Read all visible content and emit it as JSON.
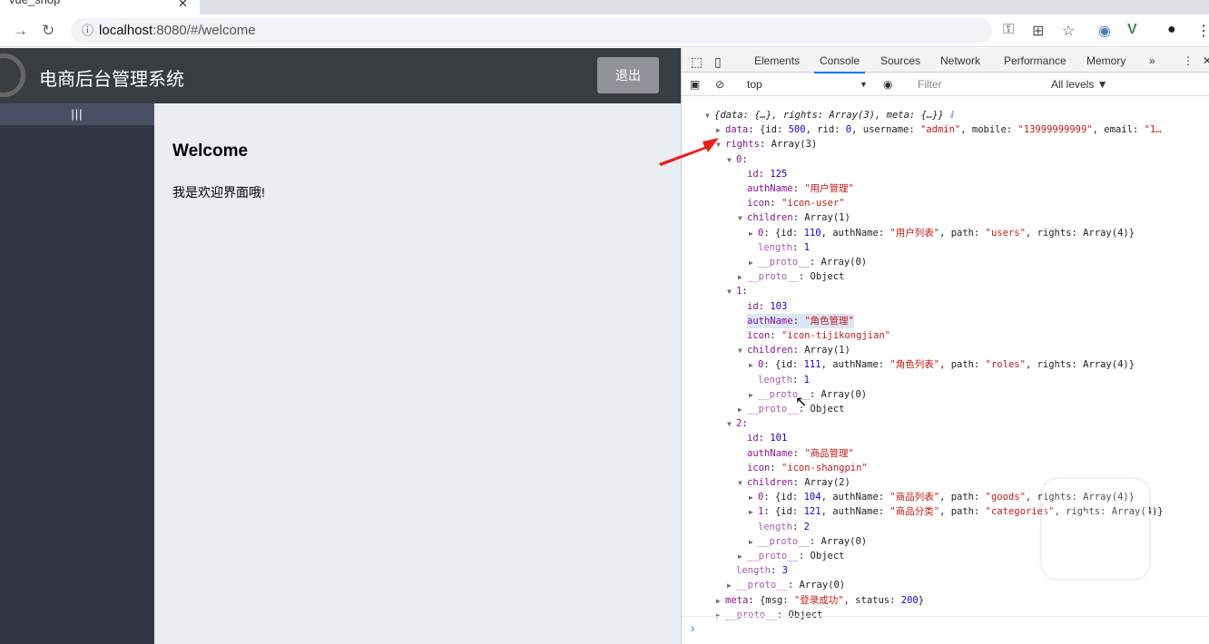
{
  "browser": {
    "tab_title": "vue_shop",
    "url_host": "localhost",
    "url_rest": ":8080/#/welcome"
  },
  "app": {
    "title": "电商后台管理系统",
    "logout": "退出",
    "toggle": "|||",
    "welcome_title": "Welcome",
    "welcome_text": "我是欢迎界面哦!"
  },
  "devtools": {
    "tabs": [
      "Elements",
      "Console",
      "Sources",
      "Network",
      "Performance",
      "Memory"
    ],
    "active_tab": "Console",
    "context": "top",
    "filter_placeholder": "Filter",
    "levels": "All levels ▼",
    "lines": [
      {
        "d": 0,
        "t": "open",
        "seg": [
          [
            "p",
            "{data: {…}, rights: Array(3), meta: {…}}"
          ]
        ],
        "italic": true
      },
      {
        "d": 1,
        "t": "closed",
        "seg": [
          [
            "k",
            "data"
          ],
          [
            "p",
            ": {id: "
          ],
          [
            "n",
            "500"
          ],
          [
            "p",
            ", rid: "
          ],
          [
            "n",
            "0"
          ],
          [
            "p",
            ", username: "
          ],
          [
            "s",
            "\"admin\""
          ],
          [
            "p",
            ", mobile: "
          ],
          [
            "s",
            "\"13999999999\""
          ],
          [
            "p",
            ", email: "
          ],
          [
            "s",
            "\"1…"
          ]
        ]
      },
      {
        "d": 1,
        "t": "open",
        "seg": [
          [
            "k",
            "rights"
          ],
          [
            "p",
            ": Array(3)"
          ]
        ]
      },
      {
        "d": 2,
        "t": "open",
        "seg": [
          [
            "k",
            "0"
          ],
          [
            "p",
            ":"
          ]
        ]
      },
      {
        "d": 3,
        "t": "leaf",
        "seg": [
          [
            "k",
            "id"
          ],
          [
            "p",
            ": "
          ],
          [
            "n",
            "125"
          ]
        ]
      },
      {
        "d": 3,
        "t": "leaf",
        "seg": [
          [
            "k",
            "authName"
          ],
          [
            "p",
            ": "
          ],
          [
            "s",
            "\"用户管理\""
          ]
        ]
      },
      {
        "d": 3,
        "t": "leaf",
        "seg": [
          [
            "k",
            "icon"
          ],
          [
            "p",
            ": "
          ],
          [
            "s",
            "\"icon-user\""
          ]
        ]
      },
      {
        "d": 3,
        "t": "open",
        "seg": [
          [
            "k",
            "children"
          ],
          [
            "p",
            ": Array(1)"
          ]
        ]
      },
      {
        "d": 4,
        "t": "closed",
        "seg": [
          [
            "k",
            "0"
          ],
          [
            "p",
            ": {id: "
          ],
          [
            "n",
            "110"
          ],
          [
            "p",
            ", authName: "
          ],
          [
            "s",
            "\"用户列表\""
          ],
          [
            "p",
            ", path: "
          ],
          [
            "s",
            "\"users\""
          ],
          [
            "p",
            ", rights: Array(4)}"
          ]
        ]
      },
      {
        "d": 4,
        "t": "leaf",
        "seg": [
          [
            "d",
            "length"
          ],
          [
            "p",
            ": "
          ],
          [
            "n",
            "1"
          ]
        ]
      },
      {
        "d": 4,
        "t": "closed",
        "seg": [
          [
            "d",
            "__proto__"
          ],
          [
            "p",
            ": Array(0)"
          ]
        ]
      },
      {
        "d": 3,
        "t": "closed",
        "seg": [
          [
            "d",
            "__proto__"
          ],
          [
            "p",
            ": Object"
          ]
        ]
      },
      {
        "d": 2,
        "t": "open",
        "seg": [
          [
            "k",
            "1"
          ],
          [
            "p",
            ":"
          ]
        ]
      },
      {
        "d": 3,
        "t": "leaf",
        "seg": [
          [
            "k",
            "id"
          ],
          [
            "p",
            ": "
          ],
          [
            "n",
            "103"
          ]
        ]
      },
      {
        "d": 3,
        "t": "leaf",
        "hl": true,
        "seg": [
          [
            "k",
            "authName"
          ],
          [
            "p",
            ": "
          ],
          [
            "s",
            "\"角色管理\""
          ]
        ]
      },
      {
        "d": 3,
        "t": "leaf",
        "seg": [
          [
            "k",
            "icon"
          ],
          [
            "p",
            ": "
          ],
          [
            "s",
            "\"icon-tijikongjian\""
          ]
        ]
      },
      {
        "d": 3,
        "t": "open",
        "seg": [
          [
            "k",
            "children"
          ],
          [
            "p",
            ": Array(1)"
          ]
        ]
      },
      {
        "d": 4,
        "t": "closed",
        "seg": [
          [
            "k",
            "0"
          ],
          [
            "p",
            ": {id: "
          ],
          [
            "n",
            "111"
          ],
          [
            "p",
            ", authName: "
          ],
          [
            "s",
            "\"角色列表\""
          ],
          [
            "p",
            ", path: "
          ],
          [
            "s",
            "\"roles\""
          ],
          [
            "p",
            ", rights: Array(4)}"
          ]
        ]
      },
      {
        "d": 4,
        "t": "leaf",
        "seg": [
          [
            "d",
            "length"
          ],
          [
            "p",
            ": "
          ],
          [
            "n",
            "1"
          ]
        ]
      },
      {
        "d": 4,
        "t": "closed",
        "seg": [
          [
            "d",
            "__proto__"
          ],
          [
            "p",
            ": Array(0)"
          ]
        ]
      },
      {
        "d": 3,
        "t": "closed",
        "seg": [
          [
            "d",
            "__proto__"
          ],
          [
            "p",
            ": Object"
          ]
        ]
      },
      {
        "d": 2,
        "t": "open",
        "seg": [
          [
            "k",
            "2"
          ],
          [
            "p",
            ":"
          ]
        ]
      },
      {
        "d": 3,
        "t": "leaf",
        "seg": [
          [
            "k",
            "id"
          ],
          [
            "p",
            ": "
          ],
          [
            "n",
            "101"
          ]
        ]
      },
      {
        "d": 3,
        "t": "leaf",
        "seg": [
          [
            "k",
            "authName"
          ],
          [
            "p",
            ": "
          ],
          [
            "s",
            "\"商品管理\""
          ]
        ]
      },
      {
        "d": 3,
        "t": "leaf",
        "seg": [
          [
            "k",
            "icon"
          ],
          [
            "p",
            ": "
          ],
          [
            "s",
            "\"icon-shangpin\""
          ]
        ]
      },
      {
        "d": 3,
        "t": "open",
        "seg": [
          [
            "k",
            "children"
          ],
          [
            "p",
            ": Array(2)"
          ]
        ]
      },
      {
        "d": 4,
        "t": "closed",
        "seg": [
          [
            "k",
            "0"
          ],
          [
            "p",
            ": {id: "
          ],
          [
            "n",
            "104"
          ],
          [
            "p",
            ", authName: "
          ],
          [
            "s",
            "\"商品列表\""
          ],
          [
            "p",
            ", path: "
          ],
          [
            "s",
            "\"goods\""
          ],
          [
            "p",
            ", rights: Array(4)}"
          ]
        ]
      },
      {
        "d": 4,
        "t": "closed",
        "seg": [
          [
            "k",
            "1"
          ],
          [
            "p",
            ": {id: "
          ],
          [
            "n",
            "121"
          ],
          [
            "p",
            ", authName: "
          ],
          [
            "s",
            "\"商品分类\""
          ],
          [
            "p",
            ", path: "
          ],
          [
            "s",
            "\"categories\""
          ],
          [
            "p",
            ", rights: Array(4)}"
          ]
        ]
      },
      {
        "d": 4,
        "t": "leaf",
        "seg": [
          [
            "d",
            "length"
          ],
          [
            "p",
            ": "
          ],
          [
            "n",
            "2"
          ]
        ]
      },
      {
        "d": 4,
        "t": "closed",
        "seg": [
          [
            "d",
            "__proto__"
          ],
          [
            "p",
            ": Array(0)"
          ]
        ]
      },
      {
        "d": 3,
        "t": "closed",
        "seg": [
          [
            "d",
            "__proto__"
          ],
          [
            "p",
            ": Object"
          ]
        ]
      },
      {
        "d": 2,
        "t": "leaf",
        "seg": [
          [
            "d",
            "length"
          ],
          [
            "p",
            ": "
          ],
          [
            "n",
            "3"
          ]
        ]
      },
      {
        "d": 2,
        "t": "closed",
        "seg": [
          [
            "d",
            "__proto__"
          ],
          [
            "p",
            ": Array(0)"
          ]
        ]
      },
      {
        "d": 1,
        "t": "closed",
        "seg": [
          [
            "k",
            "meta"
          ],
          [
            "p",
            ": {msg: "
          ],
          [
            "s",
            "\"登录成功\""
          ],
          [
            "p",
            ", status: "
          ],
          [
            "n",
            "200"
          ],
          [
            "p",
            "}"
          ]
        ]
      },
      {
        "d": 1,
        "t": "closed",
        "seg": [
          [
            "d",
            "__proto__"
          ],
          [
            "p",
            ": Object"
          ]
        ]
      }
    ]
  },
  "colors": {
    "header": "#373d41",
    "aside": "#333744",
    "main": "#eaedf1",
    "logout": "#909399",
    "annotation_arrow": "#e8231e"
  }
}
